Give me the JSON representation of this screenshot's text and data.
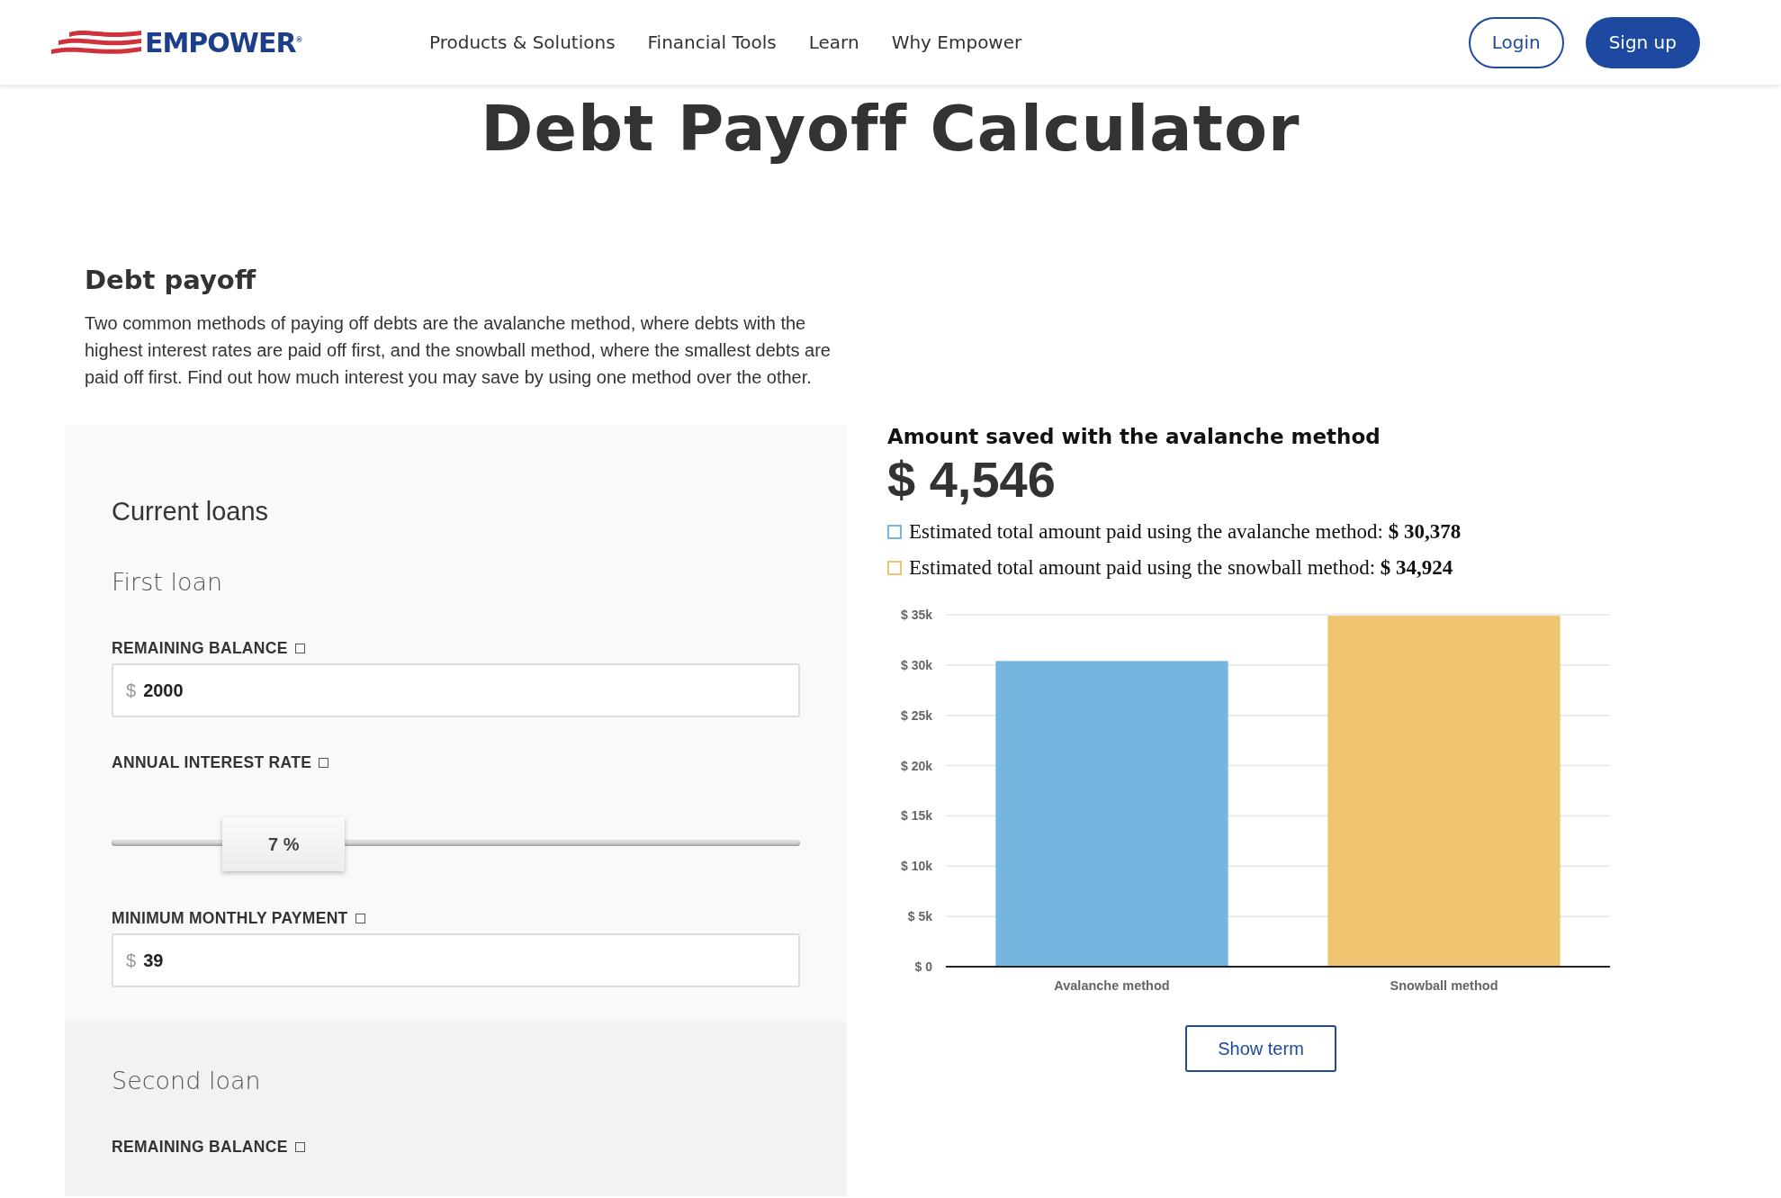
{
  "header": {
    "logo": "EMPOWER$^{®}$",
    "nav": [
      "Products & Solutions",
      "Financial Tools",
      "Learn",
      "Why Empower"
    ],
    "login": "Login",
    "signup": "Sign up"
  },
  "title": "Debt Payoff Calculator",
  "intro": {
    "heading": "Debt payoff",
    "text": "Two common methods of paying off debts are the avalanche method, where debts with the highest interest rates are paid off first, and the snowball method, where the smallest debts are paid off first. Find out how much interest you may save by using one method over the other."
  },
  "form": {
    "heading": "Current loans",
    "loans": [
      {
        "title": "First loan",
        "fields": [
          {
            "kind": "input",
            "label": "REMAINING BALANCE",
            "prefix": "$",
            "value": "2000"
          },
          {
            "kind": "slider",
            "label": "ANNUAL INTEREST RATE",
            "reading": "7 %",
            "level": 0.25
          },
          {
            "kind": "input",
            "label": "MINIMUM MONTHLY PAYMENT",
            "prefix": "$",
            "value": "39"
          }
        ]
      },
      {
        "title": "Second loan",
        "fields": [
          {
            "kind": "label",
            "label": "REMAINING BALANCE"
          }
        ]
      }
    ]
  },
  "result": {
    "heading": "Amount saved with the avalanche method",
    "amount": "$ 4,546",
    "legend": [
      {
        "text": "Estimated total amount paid using the avalanche method:",
        "total": "$ 30,378",
        "color": "#75b6e0"
      },
      {
        "text": "Estimated total amount paid using the snowball method:",
        "total": "$ 34,924",
        "color": "#f0c572"
      }
    ],
    "chart_data": {
      "type": "bar",
      "categories": [
        "Avalanche method",
        "Snowball method"
      ],
      "values": [
        30400,
        34900
      ],
      "grid": true,
      "ylim": [
        0,
        35000
      ],
      "yticks": [
        {
          "value": 0,
          "label": "$ 0"
        },
        {
          "value": 5000,
          "label": "$ 5k"
        },
        {
          "value": 10000,
          "label": "$ 10k"
        },
        {
          "value": 15000,
          "label": "$ 15k"
        },
        {
          "value": 20000,
          "label": "$ 20k"
        },
        {
          "value": 25000,
          "label": "$ 25k"
        },
        {
          "value": 30000,
          "label": "$ 30k"
        },
        {
          "value": 35000,
          "label": "$ 35k"
        }
      ]
    },
    "button": "Show term"
  }
}
